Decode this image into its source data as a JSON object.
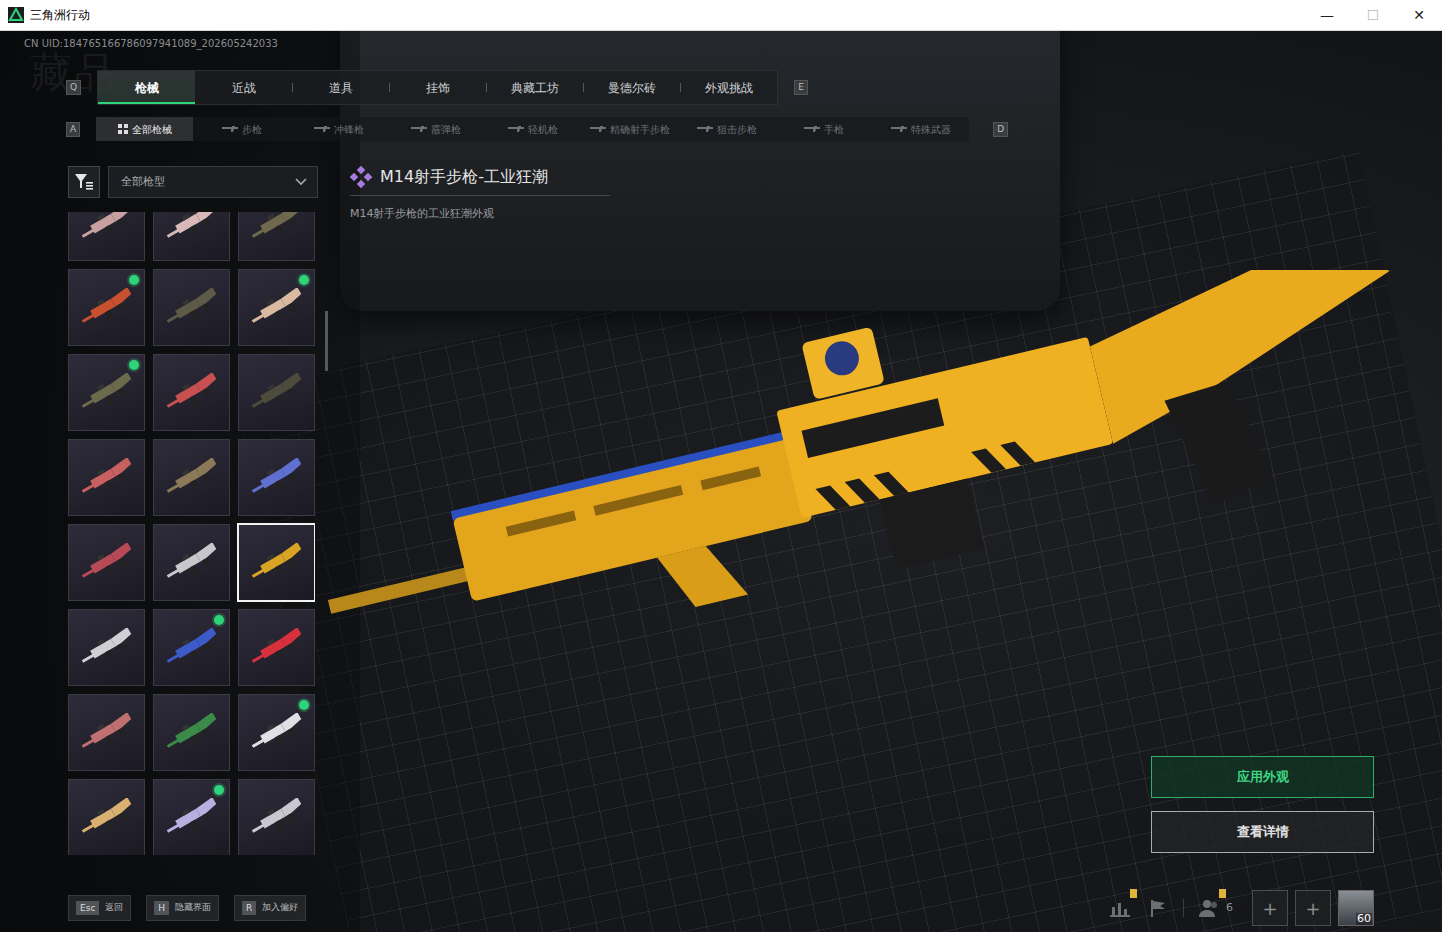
{
  "window": {
    "title": "三角洲行动",
    "controls": [
      {
        "glyph": "—",
        "disabled": false
      },
      {
        "glyph": "☐",
        "disabled": true
      },
      {
        "glyph": "✕",
        "disabled": false
      }
    ]
  },
  "watermark": "藏品",
  "uid": "CN UID:184765166786097941089_202605242033",
  "tabs": {
    "prev_key": "Q",
    "next_key": "E",
    "items": [
      {
        "label": "枪械",
        "selected": true
      },
      {
        "label": "近战",
        "selected": false
      },
      {
        "label": "道具",
        "selected": false
      },
      {
        "label": "挂饰",
        "selected": false
      },
      {
        "label": "典藏工坊",
        "selected": false
      },
      {
        "label": "曼德尔砖",
        "selected": false
      },
      {
        "label": "外观挑战",
        "selected": false
      }
    ]
  },
  "subtabs": {
    "prev_key": "A",
    "next_key": "D",
    "items": [
      {
        "label": "全部枪械",
        "selected": true
      },
      {
        "label": "步枪",
        "selected": false
      },
      {
        "label": "冲锋枪",
        "selected": false
      },
      {
        "label": "霰弹枪",
        "selected": false
      },
      {
        "label": "轻机枪",
        "selected": false
      },
      {
        "label": "精确射手步枪",
        "selected": false
      },
      {
        "label": "狙击步枪",
        "selected": false
      },
      {
        "label": "手枪",
        "selected": false
      },
      {
        "label": "特殊武器",
        "selected": false
      }
    ]
  },
  "filter": {
    "value": "全部枪型"
  },
  "item": {
    "title": "M14射手步枪-工业狂潮",
    "description": "M14射手步枪的工业狂潮外观"
  },
  "skins": [
    {
      "color": "#c9a0a0",
      "new": false,
      "selected": false
    },
    {
      "color": "#d8b8b8",
      "new": false,
      "selected": false
    },
    {
      "color": "#6f6a4e",
      "new": false,
      "selected": false
    },
    {
      "color": "#c8502e",
      "new": true,
      "selected": false
    },
    {
      "color": "#5e5a48",
      "new": false,
      "selected": false
    },
    {
      "color": "#d9b9a0",
      "new": true,
      "selected": false
    },
    {
      "color": "#6b6a4c",
      "new": true,
      "selected": false
    },
    {
      "color": "#c85050",
      "new": false,
      "selected": false
    },
    {
      "color": "#4d4c3c",
      "new": false,
      "selected": false
    },
    {
      "color": "#c86060",
      "new": false,
      "selected": false
    },
    {
      "color": "#8a7a58",
      "new": false,
      "selected": false
    },
    {
      "color": "#6070d0",
      "new": false,
      "selected": false
    },
    {
      "color": "#b84a58",
      "new": false,
      "selected": false
    },
    {
      "color": "#c8c8cc",
      "new": false,
      "selected": false
    },
    {
      "color": "#d9a323",
      "new": false,
      "selected": true
    },
    {
      "color": "#d0d0d4",
      "new": false,
      "selected": false
    },
    {
      "color": "#3c5bc8",
      "new": true,
      "selected": false
    },
    {
      "color": "#d8303c",
      "new": false,
      "selected": false
    },
    {
      "color": "#c07070",
      "new": false,
      "selected": false
    },
    {
      "color": "#3c8a48",
      "new": false,
      "selected": false
    },
    {
      "color": "#e0e0e4",
      "new": true,
      "selected": false
    },
    {
      "color": "#d8b070",
      "new": false,
      "selected": false
    },
    {
      "color": "#b8b0e0",
      "new": true,
      "selected": false
    },
    {
      "color": "#c8c8d0",
      "new": false,
      "selected": false
    }
  ],
  "scrollbar": {
    "level": 0.17
  },
  "actions": [
    {
      "label": "应用外观",
      "kind": "primary"
    },
    {
      "label": "查看详情",
      "kind": "secondary"
    }
  ],
  "hints": [
    {
      "key": "Esc",
      "label": "返回"
    },
    {
      "key": "H",
      "label": "隐藏界面"
    },
    {
      "key": "R",
      "label": "加入偏好"
    }
  ],
  "status": {
    "stats_alert": true,
    "friends_count": "6",
    "friends_alert": true,
    "slots": [
      "+",
      "+"
    ],
    "level": "60"
  }
}
